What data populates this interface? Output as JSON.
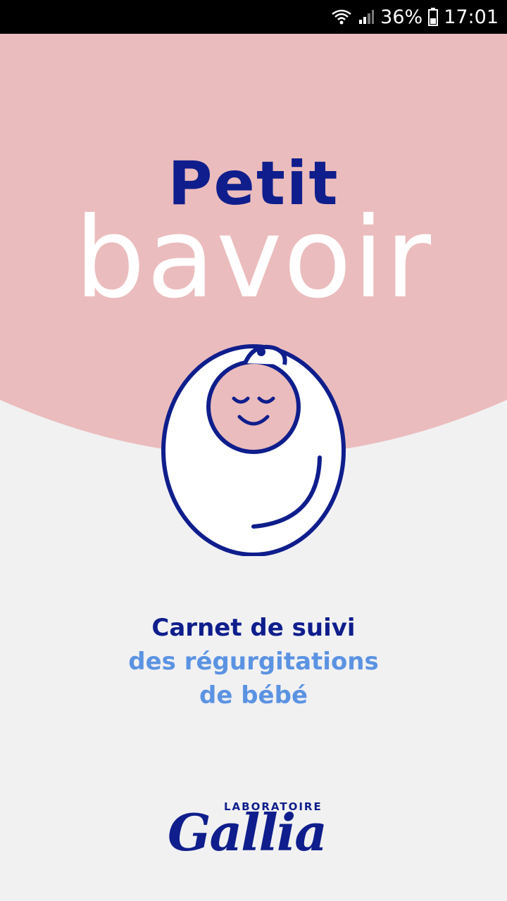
{
  "status_bar": {
    "battery_percent": "36%",
    "time": "17:01",
    "icons": [
      "wifi-icon",
      "signal-icon",
      "battery-icon"
    ]
  },
  "splash": {
    "title_line1": "Petit",
    "title_line2": "bavoir",
    "illustration": "sleeping-baby-icon",
    "subtitle_line1": "Carnet de suivi",
    "subtitle_line2": "des régurgitations",
    "subtitle_line3": "de bébé"
  },
  "brand": {
    "label": "LABORATOIRE",
    "name": "Gallia"
  },
  "colors": {
    "pink": "#ebbcbd",
    "background": "#f1f1f2",
    "navy": "#0f1e8c",
    "light_blue": "#5b93e2",
    "white": "#ffffff"
  }
}
